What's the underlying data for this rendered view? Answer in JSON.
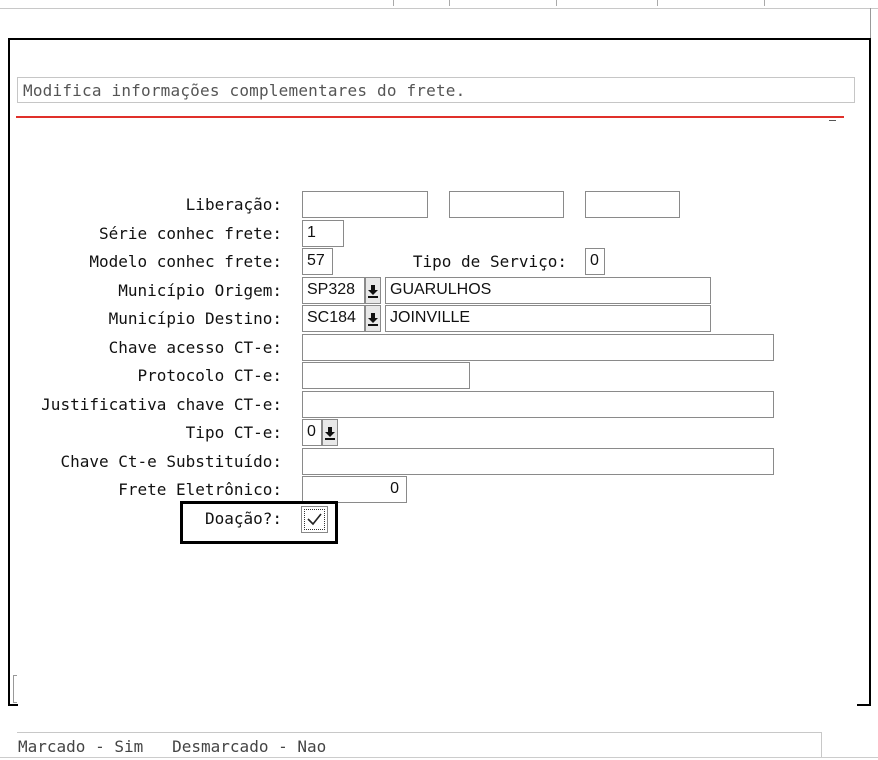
{
  "description": "Modifica informações complementares do frete.",
  "form": {
    "liberacao": {
      "label": "Liberação:",
      "value1": "",
      "value2": "",
      "value3": ""
    },
    "serie": {
      "label": "Série conhec frete:",
      "value": "1"
    },
    "modelo": {
      "label": "Modelo conhec frete:",
      "value": "57"
    },
    "tipo_servico": {
      "label": "Tipo de Serviço:",
      "value": "0"
    },
    "municipio_origem": {
      "label": "Município Origem:",
      "code": "SP328",
      "name": "GUARULHOS"
    },
    "municipio_destino": {
      "label": "Município Destino:",
      "code": "SC184",
      "name": "JOINVILLE"
    },
    "chave_acesso": {
      "label": "Chave acesso CT-e:",
      "value": ""
    },
    "protocolo": {
      "label": "Protocolo CT-e:",
      "value": ""
    },
    "justificativa": {
      "label": "Justificativa chave CT-e:",
      "value": ""
    },
    "tipo_cte": {
      "label": "Tipo CT-e:",
      "value": "0"
    },
    "chave_substituido": {
      "label": "Chave Ct-e Substituído:",
      "value": ""
    },
    "frete_eletronico": {
      "label": "Frete Eletrônico:",
      "value": "0"
    },
    "doacao": {
      "label": "Doação?:",
      "checked": true
    }
  },
  "status_bar": "Marcado - Sim   Desmarcado - Nao",
  "icons": {
    "lookup": "arrow-down-icon",
    "checkbox": "check-icon"
  }
}
